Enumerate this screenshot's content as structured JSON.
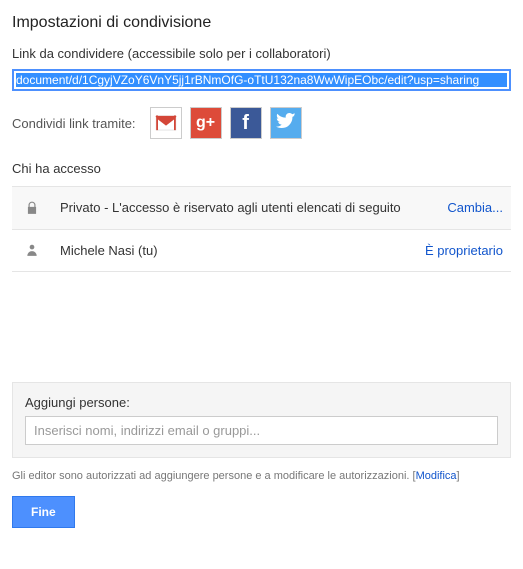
{
  "dialog": {
    "title": "Impostazioni di condivisione",
    "link_label": "Link da condividere (accessibile solo per i collaboratori)",
    "share_url": "document/d/1CgyjVZoY6VnY5jj1rBNmOfG-oTtU132na8WwWipEObc/edit?usp=sharing",
    "share_via_label": "Condividi link tramite:"
  },
  "access": {
    "header": "Chi ha accesso",
    "rows": [
      {
        "text": "Privato - L'accesso è riservato agli utenti elencati di seguito",
        "action": "Cambia..."
      },
      {
        "text": "Michele Nasi (tu)",
        "status": "È proprietario"
      }
    ]
  },
  "add": {
    "label": "Aggiungi persone:",
    "placeholder": "Inserisci nomi, indirizzi email o gruppi..."
  },
  "footer": {
    "note_prefix": "Gli editor sono autorizzati ad aggiungere persone e a modificare le autorizzazioni.  [",
    "modify": "Modifica",
    "note_suffix": "]"
  },
  "buttons": {
    "done": "Fine"
  }
}
